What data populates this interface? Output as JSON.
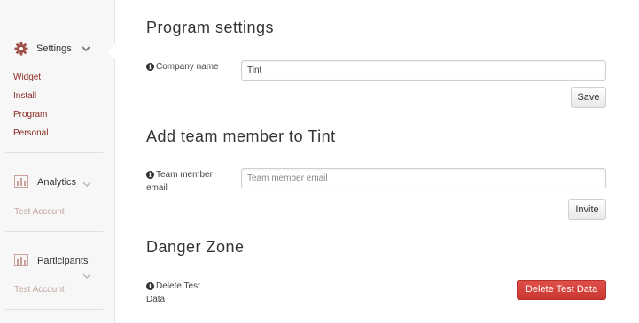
{
  "sidebar": {
    "settings": {
      "label": "Settings",
      "icon": "gear-icon"
    },
    "settings_links": [
      "Widget",
      "Install",
      "Program",
      "Personal"
    ],
    "analytics": {
      "label": "Analytics",
      "icon": "bar-chart-icon",
      "sub": "Test Account"
    },
    "participants": {
      "label": "Participants",
      "icon": "bar-chart-icon",
      "sub": "Test Account"
    }
  },
  "program_settings": {
    "title": "Program settings",
    "company_label": "Company name",
    "company_value": "Tint",
    "save_label": "Save"
  },
  "add_member": {
    "title": "Add team member to Tint",
    "email_label_line1": "Team member",
    "email_label_line2": "email",
    "email_placeholder": "Team member email",
    "invite_label": "Invite"
  },
  "danger_zone": {
    "title": "Danger Zone",
    "delete_label_line1": "Delete Test",
    "delete_label_line2": "Data",
    "delete_button": "Delete Test Data"
  },
  "colors": {
    "accent": "#8a2a22",
    "danger": "#d0413a",
    "icon": "#a0504a"
  }
}
